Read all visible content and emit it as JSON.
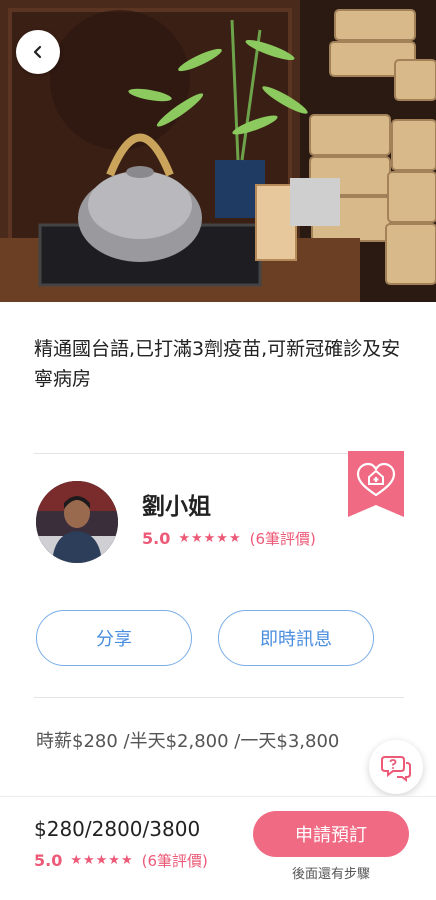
{
  "profile": {
    "description": "精通國台語,已打滿3劑疫苗,可新冠確診及安寧病房",
    "name": "劉小姐",
    "rating_score": "5.0",
    "rating_stars": "★★★★★",
    "rating_count": "(6筆評價)"
  },
  "actions": {
    "share_label": "分享",
    "message_label": "即時訊息"
  },
  "pricing": {
    "rates_line": "時薪$280 /半天$2,800 /一天$3,800",
    "summary": "$280/2800/3800"
  },
  "booking": {
    "button_label": "申請預訂",
    "hint": "後面還有步驟"
  },
  "colors": {
    "accent_pink": "#f06a83",
    "rating_pink": "#ec5a77",
    "link_blue": "#4a8ede"
  },
  "icons": {
    "back": "chevron-left-icon",
    "badge": "heart-home-icon",
    "chat": "chat-help-icon"
  }
}
